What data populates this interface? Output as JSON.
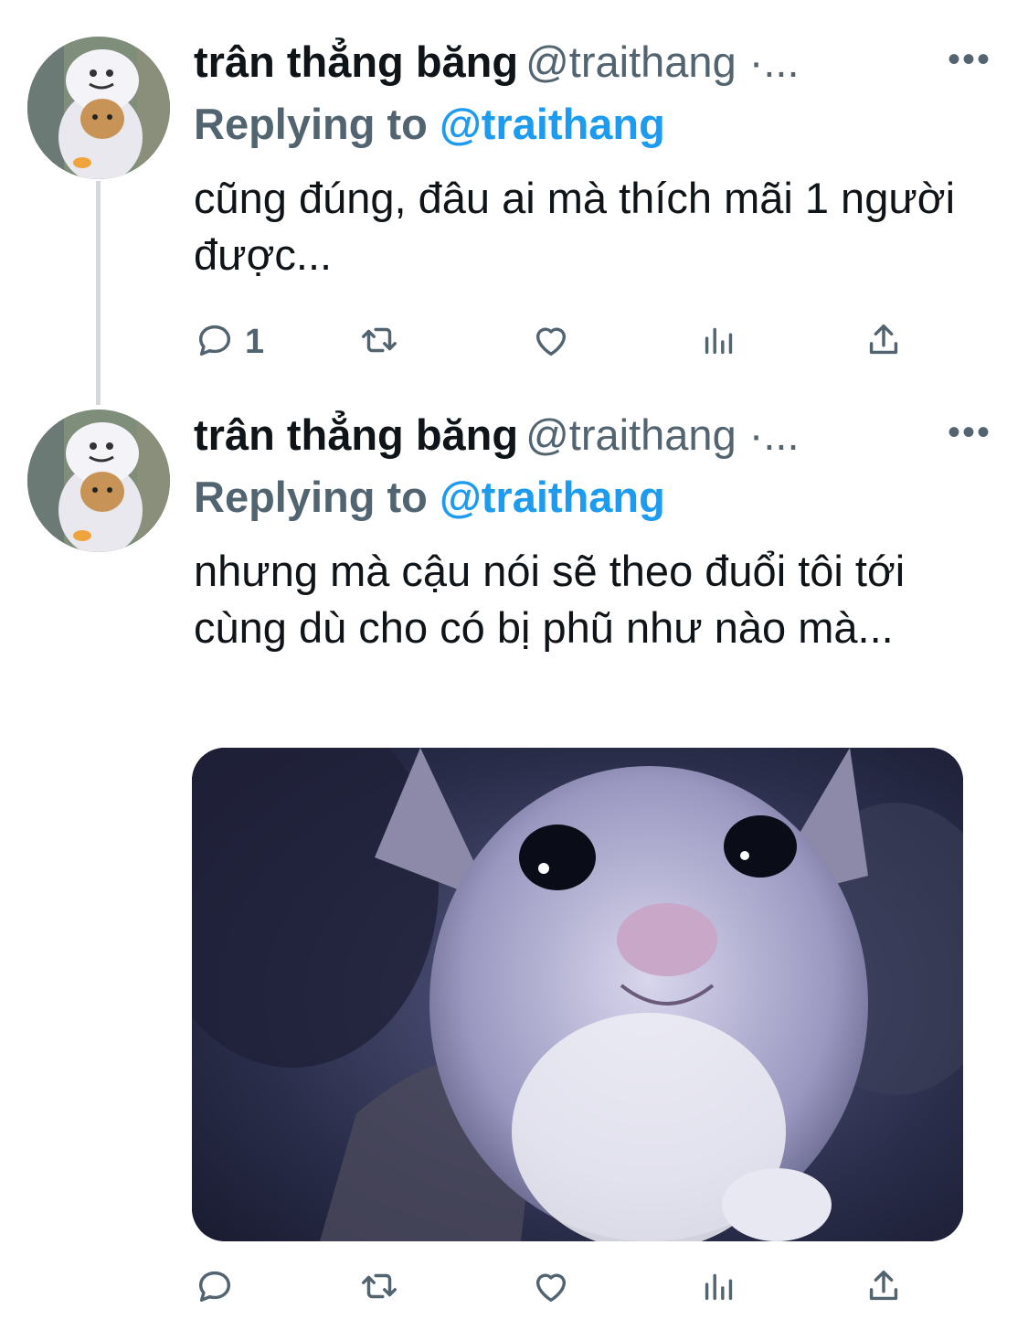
{
  "tweets": [
    {
      "author_name": "trân thẳng băng",
      "author_handle": "@traithang",
      "handle_suffix": "·...",
      "more": "•••",
      "replying_prefix": "Replying to",
      "replying_handle": "@traithang",
      "text": "cũng đúng, đâu ai mà thích mãi 1 người được...",
      "reply_count": "1"
    },
    {
      "author_name": "trân thẳng băng",
      "author_handle": "@traithang",
      "handle_suffix": "·...",
      "more": "•••",
      "replying_prefix": "Replying to",
      "replying_handle": "@traithang",
      "text": "nhưng mà cậu nói sẽ theo đuổi tôi tới cùng dù cho có bị phũ như nào mà...",
      "reply_count": ""
    }
  ],
  "icons": [
    "reply-icon",
    "retweet-icon",
    "like-icon",
    "analytics-icon",
    "share-icon"
  ],
  "colors": {
    "link": "#1d9bf0",
    "secondary": "#536471",
    "thread_line": "#cfd9de"
  }
}
